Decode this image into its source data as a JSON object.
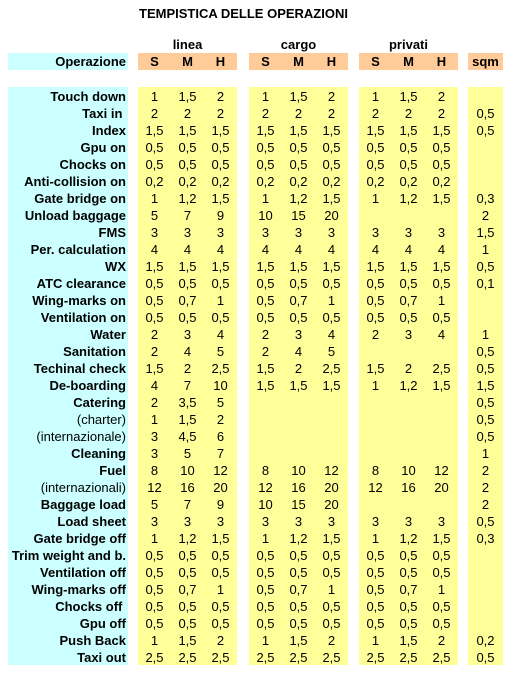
{
  "title": "TEMPISTICA DELLE OPERAZIONI",
  "colors": {
    "label_bg": "#CCFFFF",
    "header_bg": "#FFCC99",
    "data_bg": "#FFFF99"
  },
  "groups": [
    {
      "key": "linea",
      "label": "linea"
    },
    {
      "key": "cargo",
      "label": "cargo"
    },
    {
      "key": "privati",
      "label": "privati"
    }
  ],
  "header": {
    "operation_label": "Operazione",
    "sub_columns": [
      "S",
      "M",
      "H"
    ],
    "sqm_label": "sqm"
  },
  "rows": [
    {
      "label": "Touch down",
      "linea": [
        "1",
        "1,5",
        "2"
      ],
      "cargo": [
        "1",
        "1,5",
        "2"
      ],
      "privati": [
        "1",
        "1,5",
        "2"
      ],
      "sqm": ""
    },
    {
      "label": "Taxi in ",
      "linea": [
        "2",
        "2",
        "2"
      ],
      "cargo": [
        "2",
        "2",
        "2"
      ],
      "privati": [
        "2",
        "2",
        "2"
      ],
      "sqm": "0,5"
    },
    {
      "label": "Index",
      "linea": [
        "1,5",
        "1,5",
        "1,5"
      ],
      "cargo": [
        "1,5",
        "1,5",
        "1,5"
      ],
      "privati": [
        "1,5",
        "1,5",
        "1,5"
      ],
      "sqm": "0,5"
    },
    {
      "label": "Gpu on",
      "linea": [
        "0,5",
        "0,5",
        "0,5"
      ],
      "cargo": [
        "0,5",
        "0,5",
        "0,5"
      ],
      "privati": [
        "0,5",
        "0,5",
        "0,5"
      ],
      "sqm": ""
    },
    {
      "label": "Chocks on",
      "linea": [
        "0,5",
        "0,5",
        "0,5"
      ],
      "cargo": [
        "0,5",
        "0,5",
        "0,5"
      ],
      "privati": [
        "0,5",
        "0,5",
        "0,5"
      ],
      "sqm": ""
    },
    {
      "label": "Anti-collision on",
      "linea": [
        "0,2",
        "0,2",
        "0,2"
      ],
      "cargo": [
        "0,2",
        "0,2",
        "0,2"
      ],
      "privati": [
        "0,2",
        "0,2",
        "0,2"
      ],
      "sqm": ""
    },
    {
      "label": "Gate bridge on",
      "linea": [
        "1",
        "1,2",
        "1,5"
      ],
      "cargo": [
        "1",
        "1,2",
        "1,5"
      ],
      "privati": [
        "1",
        "1,2",
        "1,5"
      ],
      "sqm": "0,3"
    },
    {
      "label": "Unload baggage",
      "linea": [
        "5",
        "7",
        "9"
      ],
      "cargo": [
        "10",
        "15",
        "20"
      ],
      "privati": [
        "",
        "",
        ""
      ],
      "sqm": "2"
    },
    {
      "label": "FMS",
      "linea": [
        "3",
        "3",
        "3"
      ],
      "cargo": [
        "3",
        "3",
        "3"
      ],
      "privati": [
        "3",
        "3",
        "3"
      ],
      "sqm": "1,5"
    },
    {
      "label": "Per. calculation",
      "linea": [
        "4",
        "4",
        "4"
      ],
      "cargo": [
        "4",
        "4",
        "4"
      ],
      "privati": [
        "4",
        "4",
        "4"
      ],
      "sqm": "1"
    },
    {
      "label": "WX",
      "linea": [
        "1,5",
        "1,5",
        "1,5"
      ],
      "cargo": [
        "1,5",
        "1,5",
        "1,5"
      ],
      "privati": [
        "1,5",
        "1,5",
        "1,5"
      ],
      "sqm": "0,5"
    },
    {
      "label": "ATC clearance",
      "linea": [
        "0,5",
        "0,5",
        "0,5"
      ],
      "cargo": [
        "0,5",
        "0,5",
        "0,5"
      ],
      "privati": [
        "0,5",
        "0,5",
        "0,5"
      ],
      "sqm": "0,1"
    },
    {
      "label": "Wing-marks on",
      "linea": [
        "0,5",
        "0,7",
        "1"
      ],
      "cargo": [
        "0,5",
        "0,7",
        "1"
      ],
      "privati": [
        "0,5",
        "0,7",
        "1"
      ],
      "sqm": ""
    },
    {
      "label": "Ventilation on",
      "linea": [
        "0,5",
        "0,5",
        "0,5"
      ],
      "cargo": [
        "0,5",
        "0,5",
        "0,5"
      ],
      "privati": [
        "0,5",
        "0,5",
        "0,5"
      ],
      "sqm": ""
    },
    {
      "label": "Water",
      "linea": [
        "2",
        "3",
        "4"
      ],
      "cargo": [
        "2",
        "3",
        "4"
      ],
      "privati": [
        "2",
        "3",
        "4"
      ],
      "sqm": "1"
    },
    {
      "label": "Sanitation",
      "linea": [
        "2",
        "4",
        "5"
      ],
      "cargo": [
        "2",
        "4",
        "5"
      ],
      "privati": [
        "",
        "",
        ""
      ],
      "sqm": "0,5"
    },
    {
      "label": "Techinal check",
      "linea": [
        "1,5",
        "2",
        "2,5"
      ],
      "cargo": [
        "1,5",
        "2",
        "2,5"
      ],
      "privati": [
        "1,5",
        "2",
        "2,5"
      ],
      "sqm": "0,5"
    },
    {
      "label": "De-boarding",
      "linea": [
        "4",
        "7",
        "10"
      ],
      "cargo": [
        "1,5",
        "1,5",
        "1,5"
      ],
      "privati": [
        "1",
        "1,2",
        "1,5"
      ],
      "sqm": "1,5"
    },
    {
      "label": "Catering",
      "linea": [
        "2",
        "3,5",
        "5"
      ],
      "cargo": [
        "",
        "",
        ""
      ],
      "privati": [
        "",
        "",
        ""
      ],
      "sqm": "0,5"
    },
    {
      "label": "(charter)",
      "linea": [
        "1",
        "1,5",
        "2"
      ],
      "cargo": [
        "",
        "",
        ""
      ],
      "privati": [
        "",
        "",
        ""
      ],
      "sqm": "0,5"
    },
    {
      "label": "(internazionale)",
      "linea": [
        "3",
        "4,5",
        "6"
      ],
      "cargo": [
        "",
        "",
        ""
      ],
      "privati": [
        "",
        "",
        ""
      ],
      "sqm": "0,5"
    },
    {
      "label": "Cleaning",
      "linea": [
        "3",
        "5",
        "7"
      ],
      "cargo": [
        "",
        "",
        ""
      ],
      "privati": [
        "",
        "",
        ""
      ],
      "sqm": "1"
    },
    {
      "label": "Fuel",
      "linea": [
        "8",
        "10",
        "12"
      ],
      "cargo": [
        "8",
        "10",
        "12"
      ],
      "privati": [
        "8",
        "10",
        "12"
      ],
      "sqm": "2"
    },
    {
      "label": "(internazionali)",
      "linea": [
        "12",
        "16",
        "20"
      ],
      "cargo": [
        "12",
        "16",
        "20"
      ],
      "privati": [
        "12",
        "16",
        "20"
      ],
      "sqm": "2"
    },
    {
      "label": "Baggage load",
      "linea": [
        "5",
        "7",
        "9"
      ],
      "cargo": [
        "10",
        "15",
        "20"
      ],
      "privati": [
        "",
        "",
        ""
      ],
      "sqm": "2"
    },
    {
      "label": "Load sheet",
      "linea": [
        "3",
        "3",
        "3"
      ],
      "cargo": [
        "3",
        "3",
        "3"
      ],
      "privati": [
        "3",
        "3",
        "3"
      ],
      "sqm": "0,5"
    },
    {
      "label": "Gate bridge off",
      "linea": [
        "1",
        "1,2",
        "1,5"
      ],
      "cargo": [
        "1",
        "1,2",
        "1,5"
      ],
      "privati": [
        "1",
        "1,2",
        "1,5"
      ],
      "sqm": "0,3"
    },
    {
      "label": "Trim weight and b.",
      "linea": [
        "0,5",
        "0,5",
        "0,5"
      ],
      "cargo": [
        "0,5",
        "0,5",
        "0,5"
      ],
      "privati": [
        "0,5",
        "0,5",
        "0,5"
      ],
      "sqm": ""
    },
    {
      "label": "Ventilation off",
      "linea": [
        "0,5",
        "0,5",
        "0,5"
      ],
      "cargo": [
        "0,5",
        "0,5",
        "0,5"
      ],
      "privati": [
        "0,5",
        "0,5",
        "0,5"
      ],
      "sqm": ""
    },
    {
      "label": "Wing-marks off",
      "linea": [
        "0,5",
        "0,7",
        "1"
      ],
      "cargo": [
        "0,5",
        "0,7",
        "1"
      ],
      "privati": [
        "0,5",
        "0,7",
        "1"
      ],
      "sqm": ""
    },
    {
      "label": "Chocks off ",
      "linea": [
        "0,5",
        "0,5",
        "0,5"
      ],
      "cargo": [
        "0,5",
        "0,5",
        "0,5"
      ],
      "privati": [
        "0,5",
        "0,5",
        "0,5"
      ],
      "sqm": ""
    },
    {
      "label": "Gpu off",
      "linea": [
        "0,5",
        "0,5",
        "0,5"
      ],
      "cargo": [
        "0,5",
        "0,5",
        "0,5"
      ],
      "privati": [
        "0,5",
        "0,5",
        "0,5"
      ],
      "sqm": ""
    },
    {
      "label": "Push Back",
      "linea": [
        "1",
        "1,5",
        "2"
      ],
      "cargo": [
        "1",
        "1,5",
        "2"
      ],
      "privati": [
        "1",
        "1,5",
        "2"
      ],
      "sqm": "0,2"
    },
    {
      "label": "Taxi out",
      "linea": [
        "2,5",
        "2,5",
        "2,5"
      ],
      "cargo": [
        "2,5",
        "2,5",
        "2,5"
      ],
      "privati": [
        "2,5",
        "2,5",
        "2,5"
      ],
      "sqm": "0,5"
    }
  ]
}
